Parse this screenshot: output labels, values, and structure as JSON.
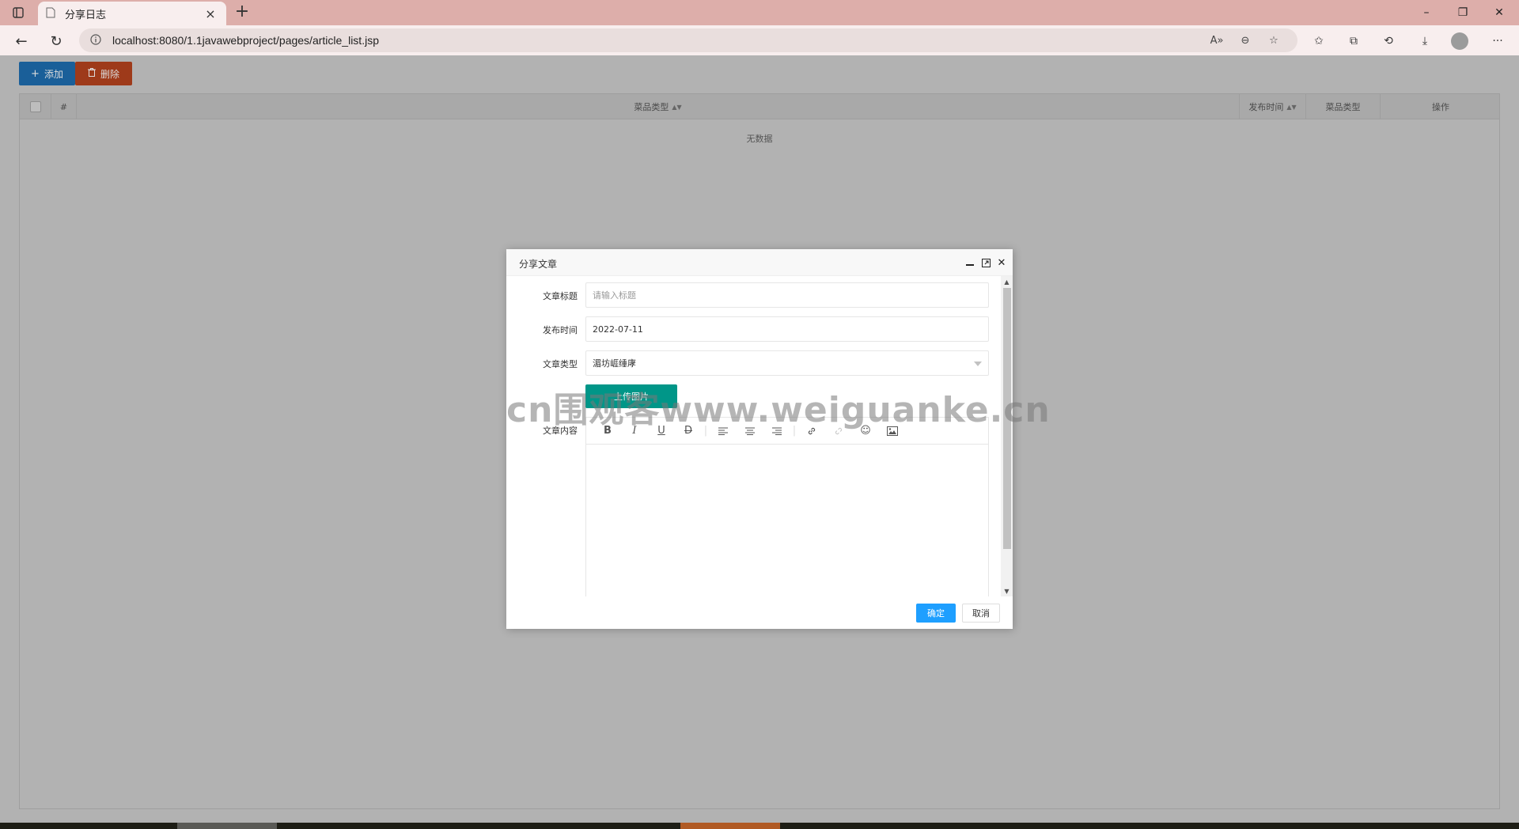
{
  "browser": {
    "tab_title": "分享日志",
    "url": "localhost:8080/1.1javawebproject/pages/article_list.jsp"
  },
  "toolbar": {
    "add_label": "添加",
    "delete_label": "删除"
  },
  "table": {
    "columns": [
      "#",
      "菜品类型",
      "发布时间",
      "菜品类型",
      "操作"
    ],
    "empty_text": "无数据"
  },
  "modal": {
    "title": "分享文章",
    "fields": {
      "title_label": "文章标题",
      "title_placeholder": "请输入标题",
      "date_label": "发布时间",
      "date_value": "2022-07-11",
      "type_label": "文章类型",
      "type_value": "湄坊崕缍庨",
      "content_label": "文章内容"
    },
    "upload_label": "上传图片",
    "ok_label": "确定",
    "cancel_label": "取消"
  },
  "watermark": "cn围观客www.weiguanke.cn",
  "colors": {
    "add_button": "#1a5f99",
    "delete_button": "#9e3a1a",
    "upload_button": "#009688",
    "confirm_button": "#1e9fff"
  }
}
